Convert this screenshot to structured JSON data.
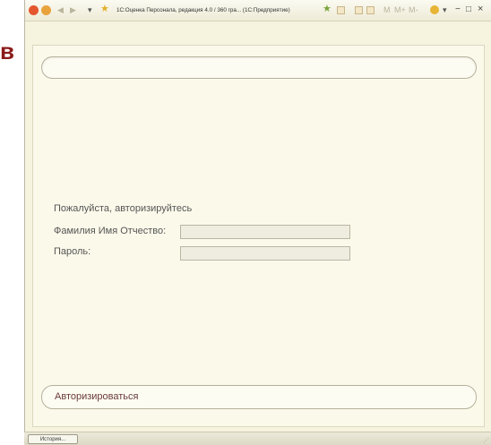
{
  "side_letter": "в",
  "titlebar": {
    "title": "1С:Оценка Персонала, редакция 4.0 / 360 гра... (1С:Предприятие)",
    "nav_back": "◀",
    "nav_forward": "▶",
    "menu": "▾",
    "fav": "★",
    "buttons": [
      "M",
      "M+",
      "M-"
    ],
    "info": "i",
    "minimize": "−",
    "maximize": "□",
    "close": "×"
  },
  "form": {
    "prompt": "Пожалуйста, авторизируйтесь",
    "name_label": "Фамилия Имя Отчество:",
    "name_value": "",
    "password_label": "Пароль:",
    "password_value": "",
    "submit_label": "Авторизироваться"
  },
  "taskbar": {
    "history_label": "История..."
  },
  "colors": {
    "accent": "#8b1a1a",
    "background": "#f6f3df"
  }
}
